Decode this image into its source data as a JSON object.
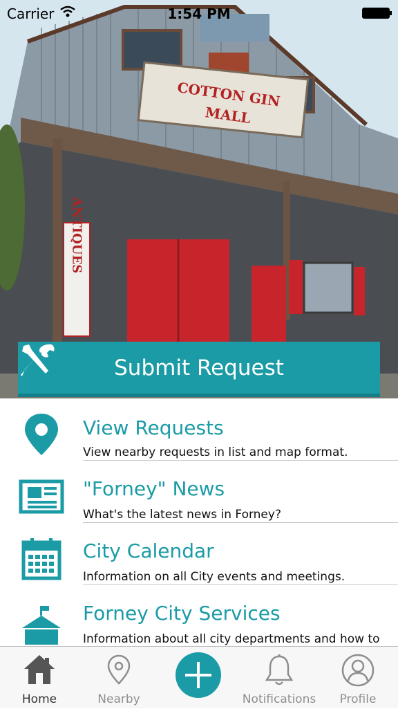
{
  "status_bar": {
    "carrier": "Carrier",
    "time": "1:54 PM"
  },
  "hero": {
    "sign_text_1": "COTTON GIN",
    "sign_text_2": "MALL",
    "side_sign": "ANTIQUES"
  },
  "submit": {
    "label": "Submit Request",
    "icon": "wrench-screwdriver-icon"
  },
  "menu": [
    {
      "title": "View Requests",
      "description": "View nearby requests in list and map format.",
      "icon": "map-pin-icon"
    },
    {
      "title": "\"Forney\" News",
      "description": "What's the latest news in Forney?",
      "icon": "newspaper-icon"
    },
    {
      "title": "City Calendar",
      "description": "Information on all City events and meetings.",
      "icon": "calendar-icon"
    },
    {
      "title": "Forney City Services",
      "description": "Information about all city departments and how to",
      "icon": "city-hall-icon"
    }
  ],
  "tabs": [
    {
      "label": "Home",
      "icon": "home-icon",
      "active": true
    },
    {
      "label": "Nearby",
      "icon": "location-pin-icon",
      "active": false
    },
    {
      "label": "",
      "icon": "plus-icon",
      "active": false
    },
    {
      "label": "Notifications",
      "icon": "bell-icon",
      "active": false
    },
    {
      "label": "Profile",
      "icon": "person-icon",
      "active": false
    }
  ],
  "colors": {
    "accent": "#1a9ba6",
    "accent_dark": "#147f89",
    "door_red": "#c8242b"
  }
}
